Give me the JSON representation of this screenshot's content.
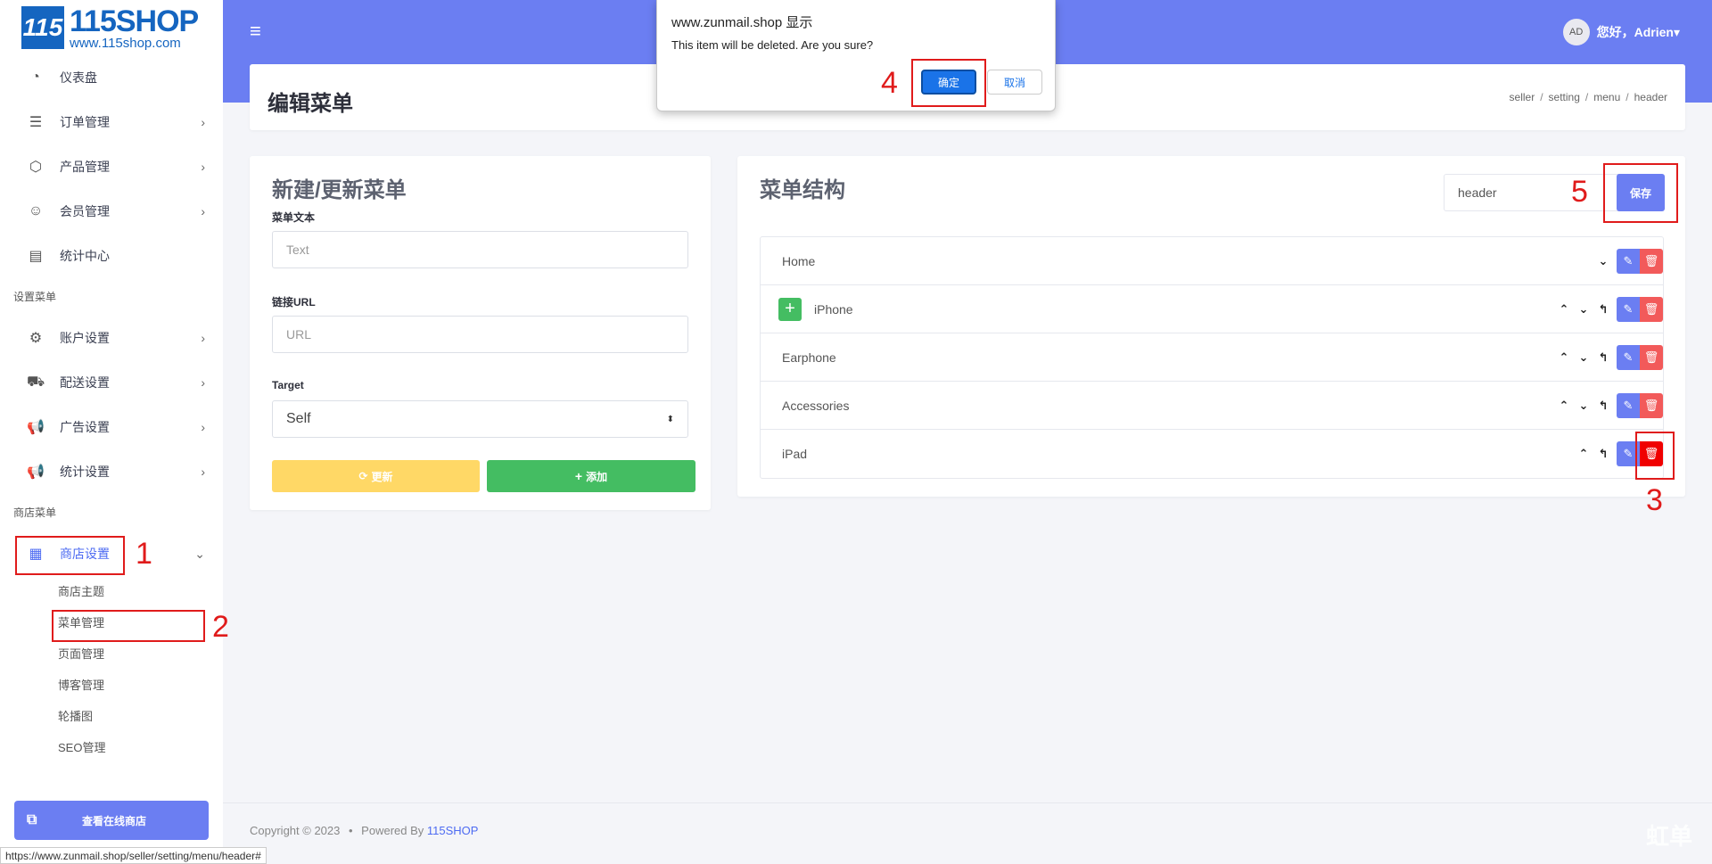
{
  "logo": {
    "mark": "115",
    "name": "115SHOP",
    "url": "www.115shop.com"
  },
  "sidebar": {
    "items": [
      {
        "label": "仪表盘",
        "icon": "dashboard-icon",
        "chev": ""
      },
      {
        "label": "订单管理",
        "icon": "orders-icon",
        "chev": "›"
      },
      {
        "label": "产品管理",
        "icon": "box-icon",
        "chev": "›"
      },
      {
        "label": "会员管理",
        "icon": "users-icon",
        "chev": "›"
      },
      {
        "label": "统计中心",
        "icon": "stats-icon",
        "chev": ""
      }
    ],
    "section_settings": "设置菜单",
    "settings_items": [
      {
        "label": "账户设置",
        "chev": "›"
      },
      {
        "label": "配送设置",
        "chev": "›"
      },
      {
        "label": "广告设置",
        "chev": "›"
      },
      {
        "label": "统计设置",
        "chev": "›"
      }
    ],
    "section_shop": "商店菜单",
    "shop_item": {
      "label": "商店设置",
      "chev": "⌄"
    },
    "sub_items": [
      "商店主题",
      "菜单管理",
      "页面管理",
      "博客管理",
      "轮播图",
      "SEO管理"
    ],
    "view_store": "查看在线商店"
  },
  "status_url": "https://www.zunmail.shop/seller/setting/menu/header#",
  "header": {
    "user_initials": "AD",
    "greeting": "您好，",
    "user_name": "Adrien",
    "caret": "▾"
  },
  "page": {
    "title": "编辑菜单",
    "breadcrumb": [
      "seller",
      "setting",
      "menu",
      "header"
    ]
  },
  "form": {
    "title": "新建/更新菜单",
    "text_label": "菜单文本",
    "text_placeholder": "Text",
    "url_label": "链接URL",
    "url_placeholder": "URL",
    "target_label": "Target",
    "target_value": "Self",
    "update_label": "更新",
    "add_label": "添加"
  },
  "structure": {
    "title": "菜单结构",
    "menu_name": "header",
    "save_label": "保存",
    "rows": [
      {
        "name": "Home"
      },
      {
        "name": "iPhone"
      },
      {
        "name": "Earphone"
      },
      {
        "name": "Accessories"
      },
      {
        "name": "iPad"
      }
    ]
  },
  "footer": {
    "copyright": "Copyright © 2023",
    "dot": "•",
    "powered": "Powered By",
    "brand": "115SHOP"
  },
  "watermark": "虹单",
  "dialog": {
    "title": "www.zunmail.shop 显示",
    "message": "This item will be deleted. Are you sure?",
    "ok": "确定",
    "cancel": "取消"
  },
  "annotations": [
    "1",
    "2",
    "3",
    "4",
    "5"
  ],
  "colors": {
    "primary": "#6b7ef2",
    "success": "#44bd62",
    "warning": "#ffd866",
    "danger": "#f25a5a",
    "annotation": "#e01b1b"
  }
}
